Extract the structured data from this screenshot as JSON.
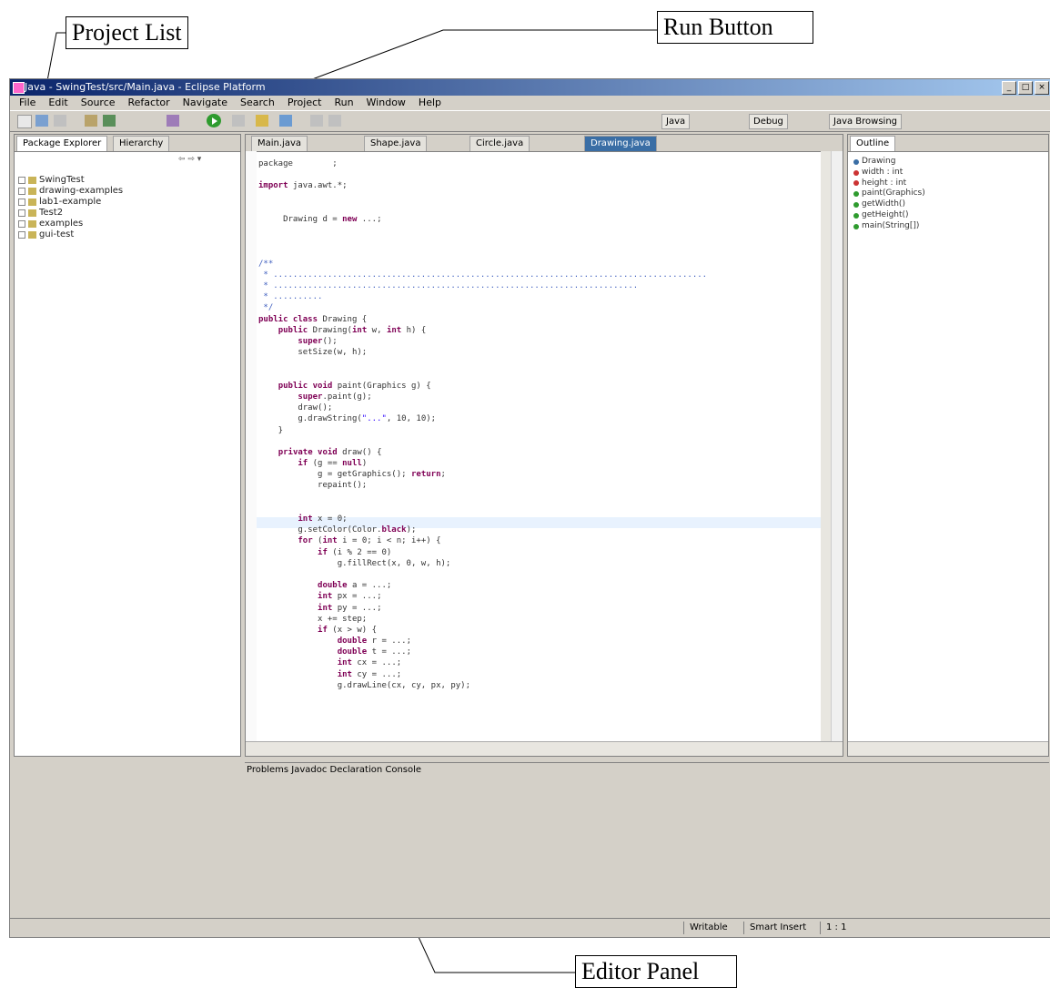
{
  "callouts": {
    "project_list": "Project List",
    "run_button": "Run Button",
    "editor_panel": "Editor Panel"
  },
  "window": {
    "title": "Java - SwingTest/src/Main.java - Eclipse Platform",
    "controls": [
      "_",
      "□",
      "×"
    ]
  },
  "menu": [
    "File",
    "Edit",
    "Source",
    "Refactor",
    "Navigate",
    "Search",
    "Project",
    "Run",
    "Window",
    "Help"
  ],
  "perspectives": [
    "Java",
    "Debug",
    "Java Browsing"
  ],
  "left_panel": {
    "tabs": [
      "Package Explorer",
      "Hierarchy"
    ],
    "items": [
      "SwingTest",
      "drawing-examples",
      "lab1-example",
      "Test2",
      "examples",
      "gui-test"
    ]
  },
  "editor": {
    "tabs": [
      "Main.java",
      "Shape.java",
      "Circle.java",
      "Drawing.java"
    ],
    "active_tab_index": 3
  },
  "outline": {
    "tab": "Outline",
    "items": [
      "Drawing",
      "width : int",
      "height : int",
      "paint(Graphics)",
      "getWidth()",
      "getHeight()",
      "main(String[])"
    ]
  },
  "console": {
    "title": "Problems  Javadoc  Declaration  Console",
    "subtitle": ""
  },
  "status": {
    "mode": "Writable",
    "insert": "Smart Insert",
    "position": "1 : 1"
  }
}
